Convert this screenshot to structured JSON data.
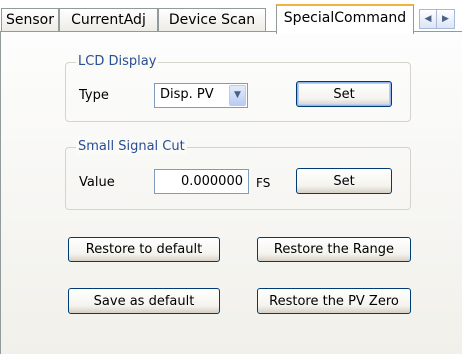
{
  "tabs": [
    {
      "label": "Sensor"
    },
    {
      "label": "CurrentAdj"
    },
    {
      "label": "Device Scan"
    },
    {
      "label": "SpecialCommand"
    }
  ],
  "tab_scroll": {
    "left_glyph": "◀",
    "right_glyph": "▶"
  },
  "lcd_display": {
    "title": "LCD Display",
    "type_label": "Type",
    "type_value": "Disp. PV",
    "dropdown_glyph": "▼",
    "set_label": "Set"
  },
  "small_signal_cut": {
    "title": "Small Signal Cut",
    "value_label": "Value",
    "value": "0.000000",
    "unit": "FS",
    "set_label": "Set"
  },
  "actions": {
    "restore_default": "Restore to default",
    "restore_range": "Restore the Range",
    "save_default": "Save as default",
    "restore_pv_zero": "Restore the PV Zero"
  },
  "colors": {
    "active_tab_accent": "#f2b33d",
    "group_title": "#2a4d97",
    "button_border": "#003c74"
  }
}
